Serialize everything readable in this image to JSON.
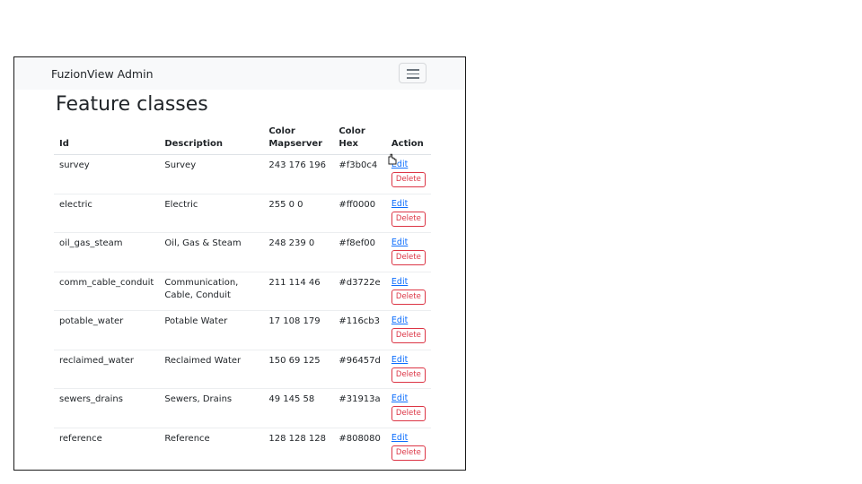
{
  "navbar": {
    "brand": "FuzionView Admin",
    "toggler_icon": "hamburger-menu-icon"
  },
  "page": {
    "title": "Feature classes"
  },
  "table": {
    "headers": {
      "id": "Id",
      "description": "Description",
      "color_mapserver_1": "Color",
      "color_mapserver_2": "Mapserver",
      "color_hex_1": "Color",
      "color_hex_2": "Hex",
      "action": "Action"
    },
    "rows": [
      {
        "id": "survey",
        "desc1": "Survey",
        "desc2": "",
        "rgb": "243 176 196",
        "hex": "#f3b0c4",
        "edit": "Edit",
        "delete": "Delete"
      },
      {
        "id": "electric",
        "desc1": "Electric",
        "desc2": "",
        "rgb": "255 0 0",
        "hex": "#ff0000",
        "edit": "Edit",
        "delete": "Delete"
      },
      {
        "id": "oil_gas_steam",
        "desc1": "Oil, Gas & Steam",
        "desc2": "",
        "rgb": "248 239 0",
        "hex": "#f8ef00",
        "edit": "Edit",
        "delete": "Delete"
      },
      {
        "id": "comm_cable_conduit",
        "desc1": "Communication,",
        "desc2": "Cable, Conduit",
        "rgb": "211 114 46",
        "hex": "#d3722e",
        "edit": "Edit",
        "delete": "Delete"
      },
      {
        "id": "potable_water",
        "desc1": "Potable Water",
        "desc2": "",
        "rgb": "17 108 179",
        "hex": "#116cb3",
        "edit": "Edit",
        "delete": "Delete"
      },
      {
        "id": "reclaimed_water",
        "desc1": "Reclaimed Water",
        "desc2": "",
        "rgb": "150 69 125",
        "hex": "#96457d",
        "edit": "Edit",
        "delete": "Delete"
      },
      {
        "id": "sewers_drains",
        "desc1": "Sewers, Drains",
        "desc2": "",
        "rgb": "49 145 58",
        "hex": "#31913a",
        "edit": "Edit",
        "delete": "Delete"
      },
      {
        "id": "reference",
        "desc1": "Reference",
        "desc2": "",
        "rgb": "128 128 128",
        "hex": "#808080",
        "edit": "Edit",
        "delete": "Delete"
      }
    ]
  },
  "colors": {
    "link": "#0d6efd",
    "danger": "#dc3545",
    "navbar_bg": "#f8f9fa"
  }
}
